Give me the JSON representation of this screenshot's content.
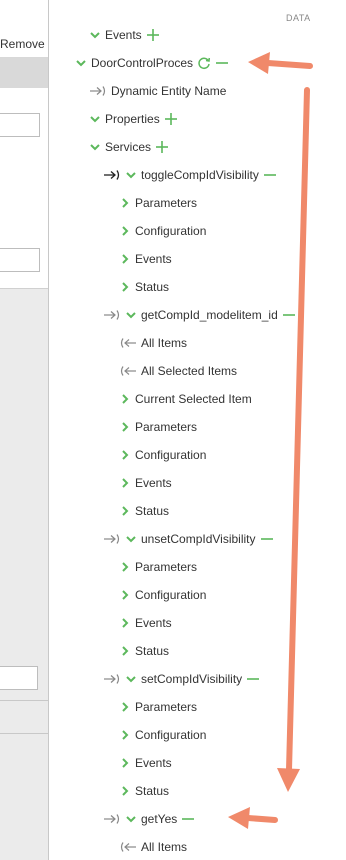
{
  "left_panel": {
    "remove_label": "Remove"
  },
  "data_header": "DATA",
  "colors": {
    "accent_green": "#5cb85c",
    "annotation_arrow": "#f0896a",
    "text": "#333333"
  },
  "tree": {
    "events_top": "Events",
    "door_control": "DoorControlProces",
    "dynamic_entity": "Dynamic Entity Name",
    "properties": "Properties",
    "services": "Services",
    "toggle": {
      "name": "toggleCompIdVisibility",
      "children": [
        "Parameters",
        "Configuration",
        "Events",
        "Status"
      ]
    },
    "getcomp": {
      "name": "getCompId_modelitem_id",
      "all_items": "All Items",
      "all_selected": "All Selected Items",
      "children": [
        "Current Selected Item",
        "Parameters",
        "Configuration",
        "Events",
        "Status"
      ]
    },
    "unset": {
      "name": "unsetCompIdVisibility",
      "children": [
        "Parameters",
        "Configuration",
        "Events",
        "Status"
      ]
    },
    "set": {
      "name": "setCompIdVisibility",
      "children": [
        "Parameters",
        "Configuration",
        "Events",
        "Status"
      ]
    },
    "getyes": {
      "name": "getYes",
      "all_items": "All Items"
    }
  }
}
